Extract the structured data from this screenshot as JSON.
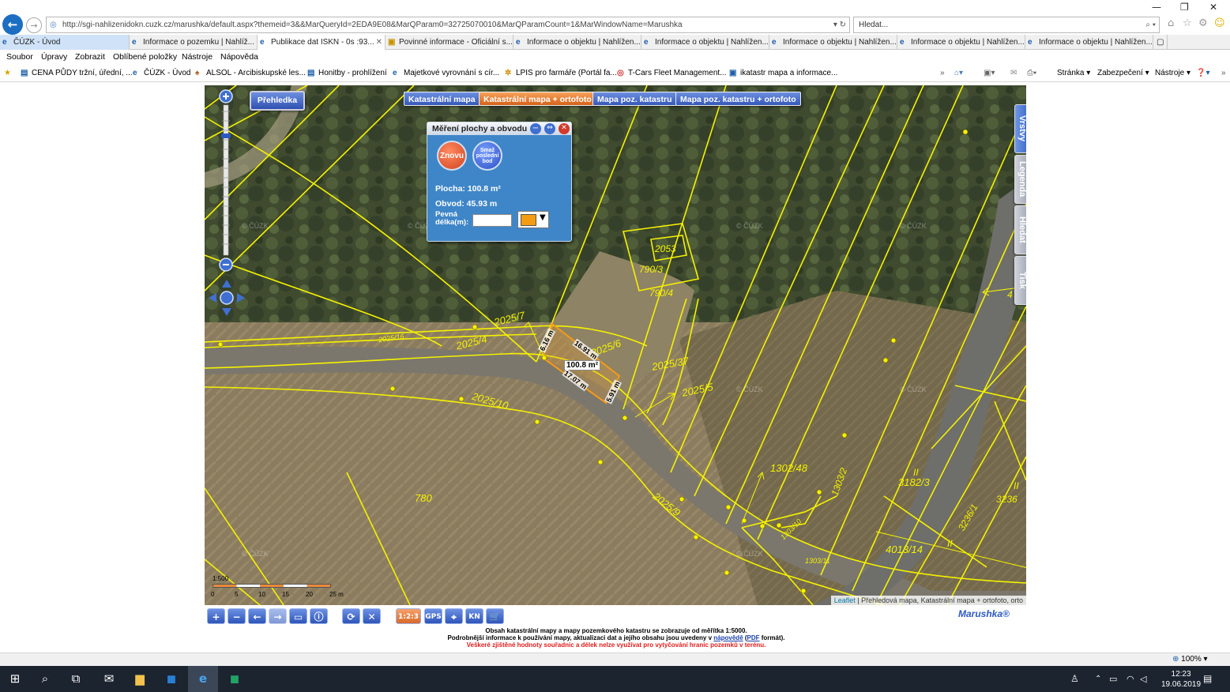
{
  "browser": {
    "url": "http://sgi-nahlizenidokn.cuzk.cz/marushka/default.aspx?themeid=3&&MarQueryId=2EDA9E08&MarQParam0=32725070010&MarQParamCount=1&MarWindowName=Marushka",
    "search_placeholder": "Hledat...",
    "tabs": [
      {
        "label": "ČÚZK - Úvod"
      },
      {
        "label": "Informace o pozemku | Nahlíž..."
      },
      {
        "label": "Publikace dat ISKN - 0s :93..."
      },
      {
        "label": "Povinné informace - Oficiální s..."
      },
      {
        "label": "Informace o objektu | Nahlížen..."
      },
      {
        "label": "Informace o objektu | Nahlížen..."
      },
      {
        "label": "Informace o objektu | Nahlížen..."
      },
      {
        "label": "Informace o objektu | Nahlížen..."
      },
      {
        "label": "Informace o objektu | Nahlížen..."
      }
    ],
    "menu": [
      "Soubor",
      "Úpravy",
      "Zobrazit",
      "Oblíbené položky",
      "Nástroje",
      "Nápověda"
    ],
    "favorites": [
      "CENA PŮDY tržní, úřední, ...",
      "ČÚZK - Úvod",
      "ALSOL - Arcibiskupské les...",
      "Honitby - prohlížení",
      "Majetkové vyrovnání s cír...",
      "LPIS pro farmáře (Portál fa...",
      "T-Cars Fleet Management...",
      "ikatastr mapa a informace..."
    ],
    "commands": [
      "Stránka",
      "Zabezpečení",
      "Nástroje"
    ]
  },
  "map": {
    "overview_button": "Přehledka",
    "layer_buttons": [
      {
        "label": "Katastrální mapa",
        "selected": false
      },
      {
        "label": "Katastrální mapa + ortofoto",
        "selected": true
      },
      {
        "label": "Mapa poz. katastru",
        "selected": false
      },
      {
        "label": "Mapa poz. katastru + ortofoto",
        "selected": false
      }
    ],
    "side_tabs": [
      "Vrstvy",
      "Legenda",
      "Hledat",
      "Tisk"
    ],
    "watermark": "© ČÚZK",
    "parcel_labels": [
      "2025/7",
      "2025/16",
      "2025/4",
      "2025/6",
      "2025/37",
      "2025/5",
      "2025/10",
      "2025/9",
      "2053",
      "790/3",
      "790/4",
      "1302/48",
      "1303/2",
      "1303/10",
      "1303/11",
      "3182/3",
      "3236/1",
      "3236",
      "4013/14",
      "780",
      "4",
      "II",
      "II",
      "II"
    ],
    "measure_labels": [
      "100.8 m²",
      "16.91 m",
      "17.07 m",
      "6.16 m",
      "5.91 m"
    ],
    "scale": {
      "ratio": "1:500",
      "ticks": [
        "0",
        "5",
        "10",
        "15",
        "20",
        "25 m"
      ]
    },
    "attribution": {
      "link": "Leaflet",
      "text": " | Přehledová mapa, Katastrální mapa + ortofoto, orto"
    },
    "brand": "Marushka®"
  },
  "measure_panel": {
    "title": "Měření plochy a obvodu",
    "again_button": "Znovu",
    "delete_button": "Smaž poslední bod",
    "area": "Plocha: 100.8 m²",
    "perimeter": "Obvod: 45.93 m",
    "fixed_length_label": "Pevná délka(m):",
    "fixed_length_value": "",
    "color": "#f39c12"
  },
  "toolbar": {
    "buttons": [
      "+",
      "−",
      "←",
      "→",
      "▭",
      "ⓘ",
      "⟳",
      "✕",
      "1:2:3",
      "GPS",
      "⌖",
      "KN",
      "🛒"
    ]
  },
  "notes": {
    "line1": "Obsah katastrální mapy a mapy pozemkového katastru se zobrazuje od měřítka 1:5000.",
    "line2_a": "Podrobnější informace k používání mapy, aktualizaci dat a jejího obsahu jsou uvedeny v",
    "line2_link1": "nápovědě",
    "line2_b": " (",
    "line2_link2": "PDF",
    "line2_c": " formát).",
    "line3": "Veškeré zjištěné hodnoty souřadnic a délek nelze využívat pro vytyčování hranic pozemků v terénu."
  },
  "status": {
    "zoom": "100%"
  },
  "taskbar": {
    "time": "12:23",
    "date": "19.06.2019"
  }
}
